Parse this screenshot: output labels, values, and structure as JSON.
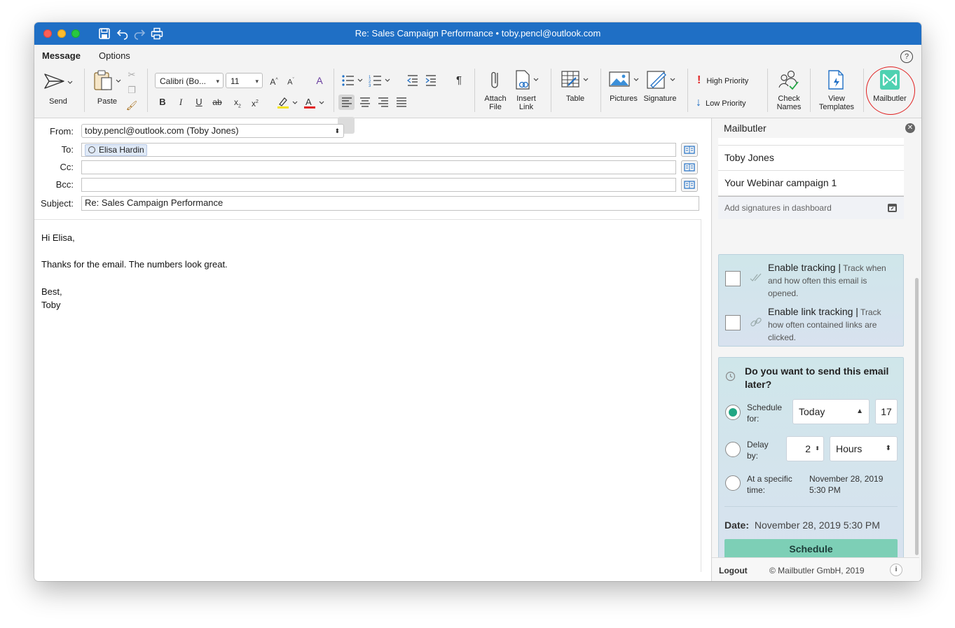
{
  "window": {
    "title": "Re: Sales Campaign Performance  • toby.pencl@outlook.com"
  },
  "ribbon": {
    "tabs": [
      {
        "label": "Message",
        "active": true
      },
      {
        "label": "Options",
        "active": false
      }
    ],
    "send": "Send",
    "paste": "Paste",
    "font_name": "Calibri (Bo...",
    "font_size": "11",
    "attach_file": [
      "Attach",
      "File"
    ],
    "insert_link": [
      "Insert",
      "Link"
    ],
    "table": "Table",
    "pictures": "Pictures",
    "signature": "Signature",
    "high_priority": "High Priority",
    "low_priority": "Low Priority",
    "check_names": [
      "Check",
      "Names"
    ],
    "view_templates": [
      "View",
      "Templates"
    ],
    "mailbutler": "Mailbutler",
    "accent": "#1f6fc5",
    "highlight_color": "#e02020"
  },
  "header": {
    "from_label": "From:",
    "from_value": "toby.pencl@outlook.com (Toby Jones)",
    "to_label": "To:",
    "to_chip": "Elisa Hardin",
    "cc_label": "Cc:",
    "bcc_label": "Bcc:",
    "subject_label": "Subject:",
    "subject_value": "Re: Sales Campaign Performance"
  },
  "body": {
    "lines": [
      "Hi Elisa,",
      "",
      "Thanks for the email. The numbers look great.",
      "",
      "Best,",
      "Toby"
    ]
  },
  "panel": {
    "title": "Mailbutler",
    "signatures": [
      "Toby Jones",
      "Your Webinar campaign 1"
    ],
    "add_signatures": "Add signatures in dashboard",
    "tracking": {
      "title": "Enable tracking |",
      "desc": " Track when and how often this email is opened.",
      "checked": false
    },
    "link_tracking": {
      "title": "Enable link tracking |",
      "desc": " Track how often contained links are clicked.",
      "checked": false
    },
    "send_later": {
      "question": "Do you want to send this email later?",
      "schedule_for_label": "Schedule for:",
      "schedule_day": "Today",
      "schedule_hour": "17",
      "delay_by_label": "Delay by:",
      "delay_value": "2",
      "delay_unit": "Hours",
      "specific_label": "At a specific time:",
      "specific_date": "November 28, 2019",
      "specific_time": "5:30 PM",
      "date_label": "Date:",
      "date_value": "November 28, 2019 5:30 PM",
      "schedule_button": "Schedule",
      "selected_option": "schedule_for",
      "accent": "#22a784"
    },
    "footer": {
      "logout": "Logout",
      "copyright": "© Mailbutler GmbH, 2019",
      "info": "i"
    }
  }
}
